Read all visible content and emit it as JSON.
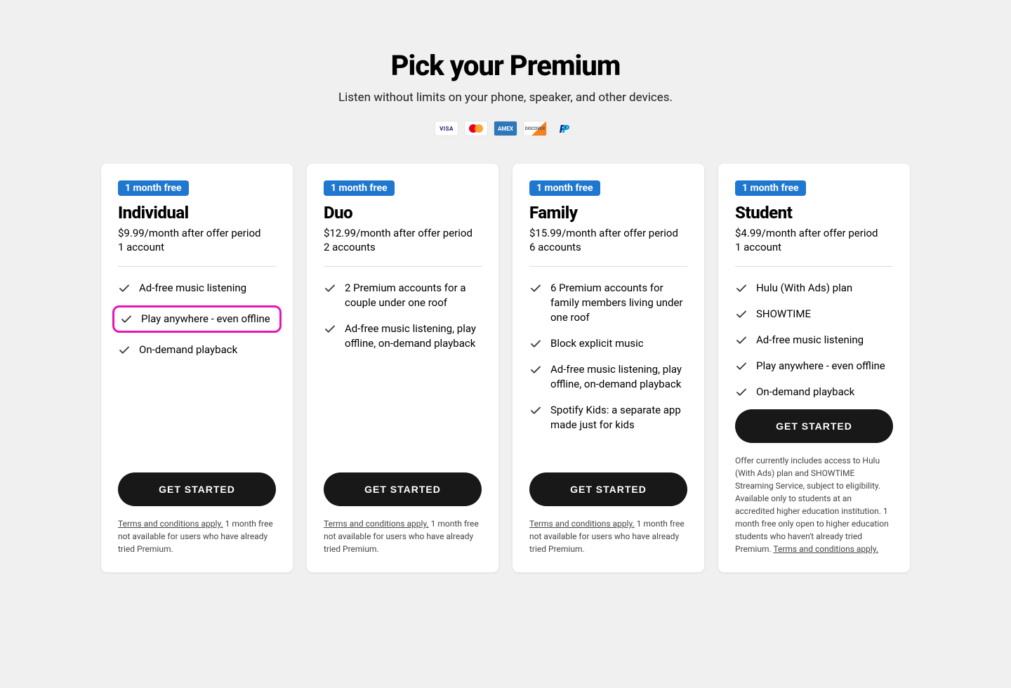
{
  "header": {
    "title": "Pick your Premium",
    "subtitle": "Listen without limits on your phone, speaker, and other devices.",
    "payment_methods": [
      "visa",
      "mastercard",
      "amex",
      "discover",
      "paypal"
    ]
  },
  "plans": [
    {
      "badge": "1 month free",
      "name": "Individual",
      "price": "$9.99/month after offer period",
      "accounts": "1 account",
      "features": [
        {
          "text": "Ad-free music listening",
          "highlighted": false
        },
        {
          "text": "Play anywhere - even offline",
          "highlighted": true
        },
        {
          "text": "On-demand playback",
          "highlighted": false
        }
      ],
      "cta": "GET STARTED",
      "fineprint_link": "Terms and conditions apply.",
      "fineprint_rest": " 1 month free not available for users who have already tried Premium."
    },
    {
      "badge": "1 month free",
      "name": "Duo",
      "price": "$12.99/month after offer period",
      "accounts": "2 accounts",
      "features": [
        {
          "text": "2 Premium accounts for a couple under one roof",
          "highlighted": false
        },
        {
          "text": "Ad-free music listening, play offline, on-demand playback",
          "highlighted": false
        }
      ],
      "cta": "GET STARTED",
      "fineprint_link": "Terms and conditions apply.",
      "fineprint_rest": " 1 month free not available for users who have already tried Premium."
    },
    {
      "badge": "1 month free",
      "name": "Family",
      "price": "$15.99/month after offer period",
      "accounts": "6 accounts",
      "features": [
        {
          "text": "6 Premium accounts for family members living under one roof",
          "highlighted": false
        },
        {
          "text": "Block explicit music",
          "highlighted": false
        },
        {
          "text": "Ad-free music listening, play offline, on-demand playback",
          "highlighted": false
        },
        {
          "text": "Spotify Kids: a separate app made just for kids",
          "highlighted": false
        }
      ],
      "cta": "GET STARTED",
      "fineprint_link": "Terms and conditions apply.",
      "fineprint_rest": " 1 month free not available for users who have already tried Premium."
    },
    {
      "badge": "1 month free",
      "name": "Student",
      "price": "$4.99/month after offer period",
      "accounts": "1 account",
      "features": [
        {
          "text": "Hulu (With Ads) plan",
          "highlighted": false
        },
        {
          "text": "SHOWTIME",
          "highlighted": false
        },
        {
          "text": "Ad-free music listening",
          "highlighted": false
        },
        {
          "text": "Play anywhere - even offline",
          "highlighted": false
        },
        {
          "text": "On-demand playback",
          "highlighted": false
        }
      ],
      "cta": "GET STARTED",
      "fineprint_pre": "Offer currently includes access to Hulu (With Ads) plan and SHOWTIME Streaming Service, subject to eligibility. Available only to students at an accredited higher education institution. 1 month free only open to higher education students who haven't already tried Premium. ",
      "fineprint_link": "Terms and conditions apply."
    }
  ]
}
